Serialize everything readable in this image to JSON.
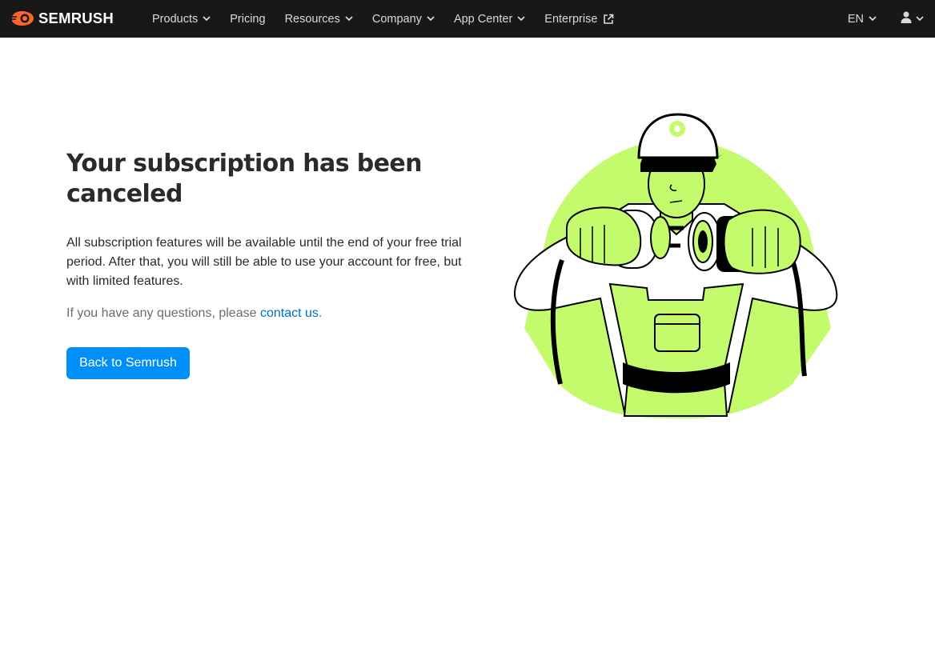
{
  "header": {
    "logo_text": "SEMRUSH",
    "nav": [
      {
        "label": "Products",
        "dropdown": true
      },
      {
        "label": "Pricing",
        "dropdown": false
      },
      {
        "label": "Resources",
        "dropdown": true
      },
      {
        "label": "Company",
        "dropdown": true
      },
      {
        "label": "App Center",
        "dropdown": true
      },
      {
        "label": "Enterprise",
        "external": true
      }
    ],
    "language": "EN"
  },
  "main": {
    "title": "Your subscription has been canceled",
    "description": "All subscription features will be available until the end of your free trial period. After that, you will still be able to use your account for free, but with limited features.",
    "question_prefix": "If you have any questions, please",
    "contact_link": "contact us",
    "question_suffix": ".",
    "back_button": "Back to Semrush"
  },
  "colors": {
    "header_bg": "#181818",
    "brand_orange": "#ff642d",
    "button_blue": "#008ff8",
    "link_blue": "#006dca",
    "illustration_green": "#c4fb6d"
  }
}
